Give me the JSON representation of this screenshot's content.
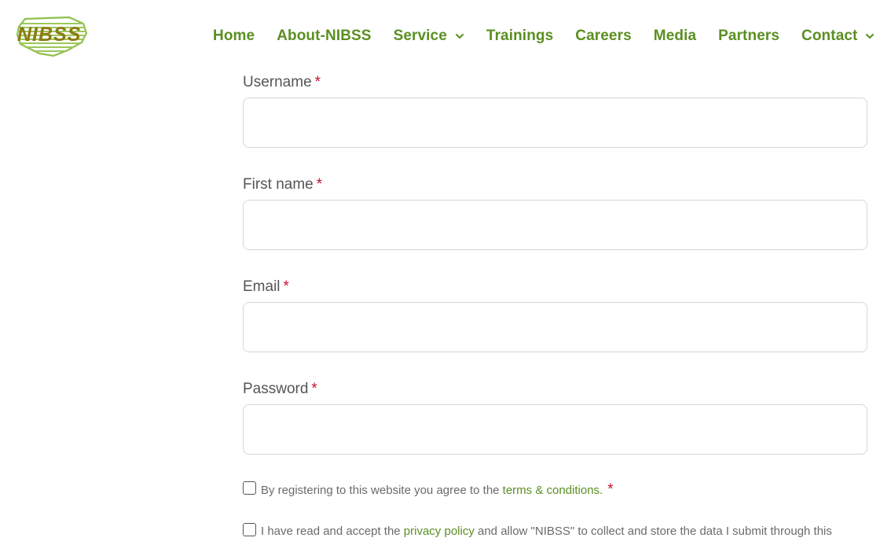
{
  "header": {
    "logo_text": "NIBSS",
    "nav": [
      {
        "label": "Home",
        "dropdown": false
      },
      {
        "label": "About-NIBSS",
        "dropdown": false
      },
      {
        "label": "Service",
        "dropdown": true
      },
      {
        "label": "Trainings",
        "dropdown": false
      },
      {
        "label": "Careers",
        "dropdown": false
      },
      {
        "label": "Media",
        "dropdown": false
      },
      {
        "label": "Partners",
        "dropdown": false
      },
      {
        "label": "Contact",
        "dropdown": true
      }
    ]
  },
  "form": {
    "required_marker": "*",
    "fields": [
      {
        "label": "Username",
        "value": "",
        "placeholder": ""
      },
      {
        "label": "First name",
        "value": "",
        "placeholder": ""
      },
      {
        "label": "Email",
        "value": "",
        "placeholder": ""
      },
      {
        "label": "Password",
        "value": "",
        "placeholder": ""
      }
    ],
    "terms": {
      "before": "By registering to this website you agree to the ",
      "link": "terms & conditions.",
      "required_marker": "*"
    },
    "privacy": {
      "before": "I have read and accept the ",
      "link": "privacy policy",
      "after": " and allow \"NIBSS\" to collect and store the data I submit through this"
    }
  },
  "colors": {
    "nav_green": "#5b8f22",
    "required_red": "#c8102e",
    "logo_gold": "#8c7a12",
    "logo_green": "#8fbf4a"
  }
}
